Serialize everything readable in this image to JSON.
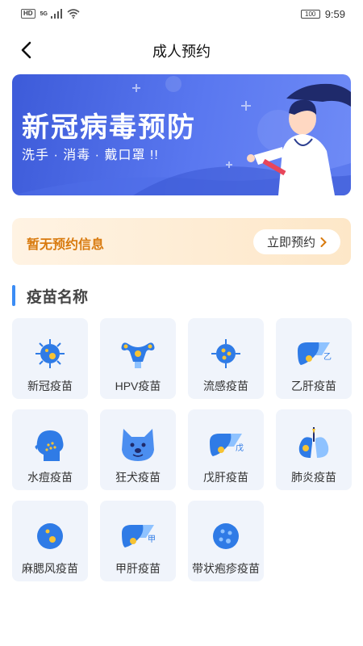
{
  "status_bar": {
    "hd": "HD",
    "network": "5G",
    "battery": "100",
    "time": "9:59"
  },
  "header": {
    "title": "成人预约"
  },
  "banner": {
    "title": "新冠病毒预防",
    "subtitle": "洗手 · 消毒 · 戴口罩 !!"
  },
  "appointment": {
    "empty_text": "暂无预约信息",
    "button_label": "立即预约"
  },
  "section": {
    "title": "疫苗名称"
  },
  "vaccines": [
    {
      "label": "新冠疫苗",
      "icon": "virus-icon"
    },
    {
      "label": "HPV疫苗",
      "icon": "uterus-icon"
    },
    {
      "label": "流感疫苗",
      "icon": "flu-virus-icon"
    },
    {
      "label": "乙肝疫苗",
      "icon": "liver-b-icon"
    },
    {
      "label": "水痘疫苗",
      "icon": "chickenpox-head-icon"
    },
    {
      "label": "狂犬疫苗",
      "icon": "dog-face-icon"
    },
    {
      "label": "戊肝疫苗",
      "icon": "liver-e-icon"
    },
    {
      "label": "肺炎疫苗",
      "icon": "lungs-icon"
    },
    {
      "label": "麻腮风疫苗",
      "icon": "measles-cell-icon"
    },
    {
      "label": "甲肝疫苗",
      "icon": "liver-a-icon"
    },
    {
      "label": "带状疱疹疫苗",
      "icon": "shingles-cell-icon"
    }
  ],
  "icon_marks": {
    "liver_b": "乙",
    "liver_e": "戊",
    "liver_a": "甲"
  },
  "colors": {
    "accent_blue": "#3b8cf5",
    "icon_blue": "#2f7be6",
    "icon_yellow": "#f7c333",
    "banner_blue": "#4a68e6",
    "appt_orange": "#d87a0e",
    "tile_bg": "#f0f4fb"
  }
}
